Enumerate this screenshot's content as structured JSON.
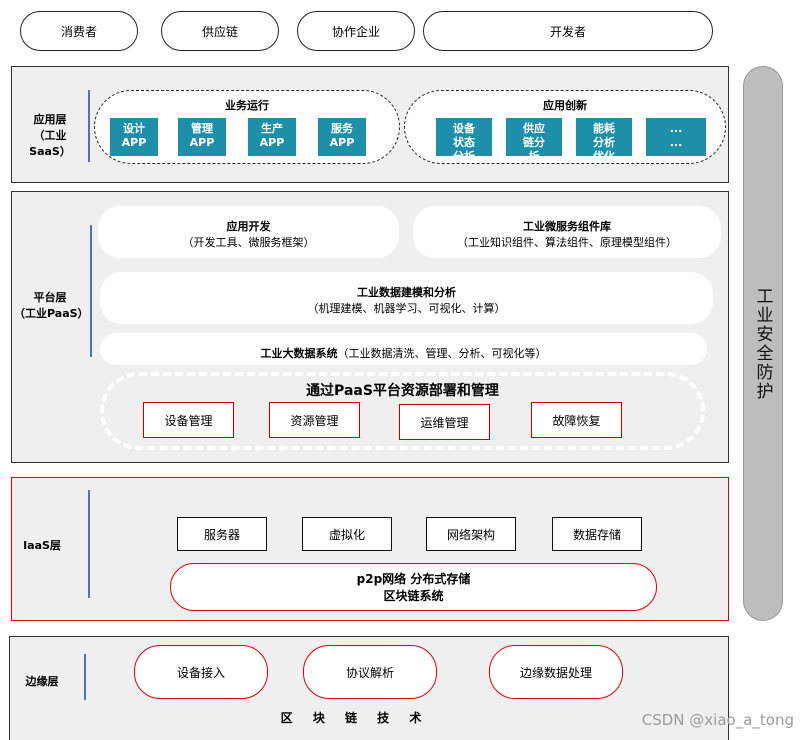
{
  "top_pills": [
    "消费者",
    "供应链",
    "协作企业",
    "开发者"
  ],
  "security": {
    "label": "工业安全防护"
  },
  "app_layer": {
    "label_line1": "应用层",
    "label_line2": "（工业SaaS）",
    "biz": {
      "title": "业务运行",
      "tiles": [
        [
          "设计",
          "APP"
        ],
        [
          "管理",
          "APP"
        ],
        [
          "生产",
          "APP"
        ],
        [
          "服务",
          "APP"
        ]
      ]
    },
    "innov": {
      "title": "应用创新",
      "tiles": [
        [
          "设备",
          "状态",
          "分析"
        ],
        [
          "供应",
          "链分",
          "析"
        ],
        [
          "能耗",
          "分析",
          "优化"
        ],
        [
          "...",
          "..."
        ]
      ]
    }
  },
  "platform_layer": {
    "label_line1": "平台层",
    "label_line2": "（工业PaaS）",
    "app_dev": {
      "title": "应用开发",
      "sub": "（开发工具、微服务框架）"
    },
    "micro": {
      "title": "工业微服务组件库",
      "sub": "（工业知识组件、算法组件、原理模型组件）"
    },
    "modeling": {
      "title": "工业数据建模和分析",
      "sub": "（机理建模、机器学习、可视化、计算）"
    },
    "bigdata": {
      "title": "工业大数据系统",
      "sub": "（工业数据清洗、管理、分析、可视化等）"
    },
    "paas_mgmt": {
      "title": "通过PaaS平台资源部署和管理",
      "boxes": [
        "设备管理",
        "资源管理",
        "运维管理",
        "故障恢复"
      ]
    }
  },
  "iaas_layer": {
    "label": "IaaS层",
    "boxes": [
      "服务器",
      "虚拟化",
      "网络架构",
      "数据存储"
    ],
    "pill_line1": "p2p网络 分布式存储",
    "pill_line2": "区块链系统"
  },
  "edge_layer": {
    "label": "边缘层",
    "pills": [
      "设备接入",
      "协议解析",
      "边缘数据处理"
    ],
    "footer": "区 块 链 技 术"
  },
  "watermark": "CSDN @xiao_a_tong"
}
